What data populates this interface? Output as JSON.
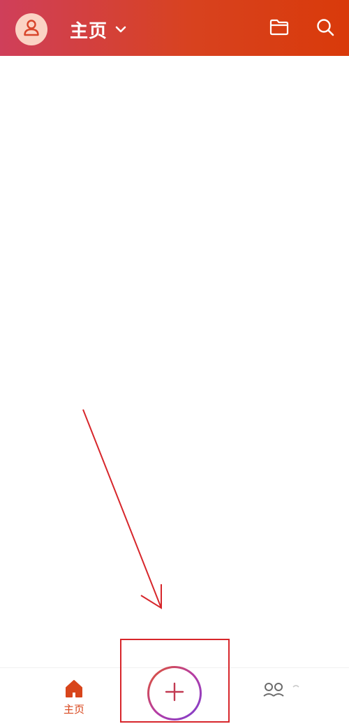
{
  "header": {
    "title": "主页",
    "avatar_icon": "user-icon",
    "dropdown_icon": "chevron-down-icon",
    "folder_icon": "folder-icon",
    "search_icon": "search-icon"
  },
  "bottom_nav": {
    "home_label": "主页",
    "home_icon": "home-icon",
    "add_icon": "plus-icon",
    "people_icon": "people-icon"
  },
  "colors": {
    "header_start": "#cf3f5a",
    "header_end": "#d93a0a",
    "accent": "#d8451b",
    "annotation": "#d7262b"
  }
}
